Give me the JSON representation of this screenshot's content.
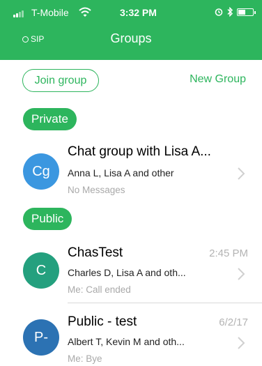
{
  "status_bar": {
    "carrier": "T-Mobile",
    "time": "3:32 PM"
  },
  "header": {
    "sip_label": "SIP",
    "title": "Groups"
  },
  "actions": {
    "join_label": "Join group",
    "new_label": "New Group"
  },
  "sections": {
    "private_label": "Private",
    "public_label": "Public"
  },
  "private_groups": [
    {
      "initials": "Cg",
      "name": "Chat group with Lisa A...",
      "members": "Anna L, Lisa A and other",
      "last_message": "No Messages",
      "time": "",
      "avatar_color": "#3b97e0"
    }
  ],
  "public_groups": [
    {
      "initials": "C",
      "name": "ChasTest",
      "members": "Charles D, Lisa A and oth...",
      "last_message": "Me: Call ended",
      "time": "2:45 PM",
      "avatar_color": "#24a07e"
    },
    {
      "initials": "P-",
      "name": "Public - test",
      "members": "Albert T, Kevin M and oth...",
      "last_message": "Me: Bye",
      "time": "6/2/17",
      "avatar_color": "#2c72b3"
    }
  ],
  "colors": {
    "accent": "#2db55d"
  }
}
